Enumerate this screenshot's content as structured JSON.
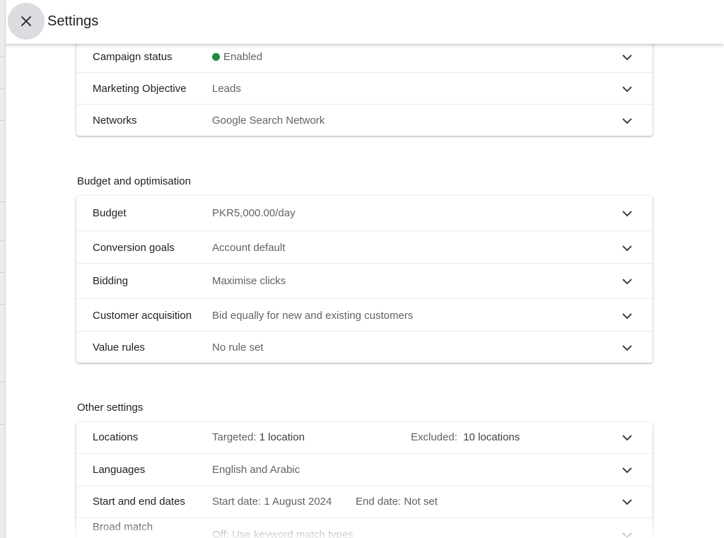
{
  "header": {
    "title": "Settings",
    "close_icon": "close-icon"
  },
  "colors": {
    "enabled_dot": "#1e8e3e",
    "close_bg": "#dadce0"
  },
  "campaign_card": {
    "rows": [
      {
        "label": "Campaign status",
        "value": "Enabled",
        "status_icon": "green-dot"
      },
      {
        "label": "Marketing Objective",
        "value": "Leads"
      },
      {
        "label": "Networks",
        "value": "Google Search Network"
      }
    ]
  },
  "budget_section": {
    "title": "Budget and optimisation",
    "rows": [
      {
        "label": "Budget",
        "value": "PKR5,000.00/day"
      },
      {
        "label": "Conversion goals",
        "value": "Account default"
      },
      {
        "label": "Bidding",
        "value": "Maximise clicks"
      },
      {
        "label": "Customer acquisition",
        "value": "Bid equally for new and existing customers"
      },
      {
        "label": "Value rules",
        "value": "No rule set"
      }
    ]
  },
  "other_section": {
    "title": "Other settings",
    "locations": {
      "label": "Locations",
      "targeted_prefix": "Targeted: ",
      "targeted_value": "1 location",
      "excluded_prefix": "Excluded: ",
      "excluded_value": "10 locations"
    },
    "languages": {
      "label": "Languages",
      "value": "English and Arabic"
    },
    "dates": {
      "label": "Start and end dates",
      "start": "Start date: 1 August 2024",
      "end": "End date: Not set"
    },
    "broad_match": {
      "label": "Broad match",
      "value": "Off: Use keyword match types"
    }
  }
}
